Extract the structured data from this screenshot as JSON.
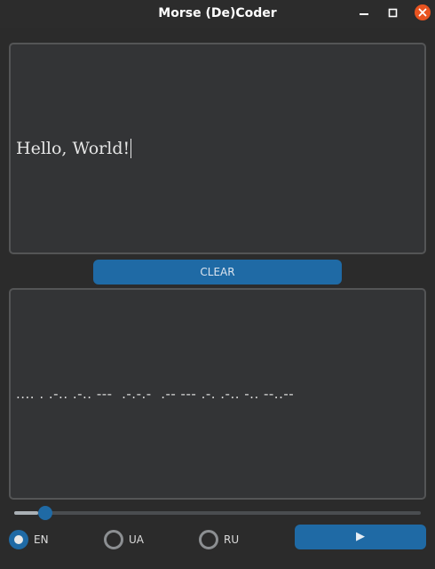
{
  "window": {
    "title": "Morse (De)Coder",
    "controls": {
      "minimize": "minimize-icon",
      "maximize": "maximize-icon",
      "close": "close-icon",
      "close_color": "#e95420"
    }
  },
  "input": {
    "text": "Hello, World!"
  },
  "clear_button": {
    "label": "CLEAR"
  },
  "output": {
    "text": ".... . .-.. .-.. ---  .-.-.-  .-- --- .-. .-.. -.. --..--"
  },
  "speed_slider": {
    "value_fraction": 0.06
  },
  "languages": [
    {
      "label": "EN",
      "selected": true
    },
    {
      "label": "UA",
      "selected": false
    },
    {
      "label": "RU",
      "selected": false
    }
  ],
  "play_button": {
    "icon": "play-icon",
    "glyph": "▶"
  },
  "colors": {
    "accent": "#1f6aa5",
    "background": "#2b2b2b",
    "textbox": "#333436"
  }
}
